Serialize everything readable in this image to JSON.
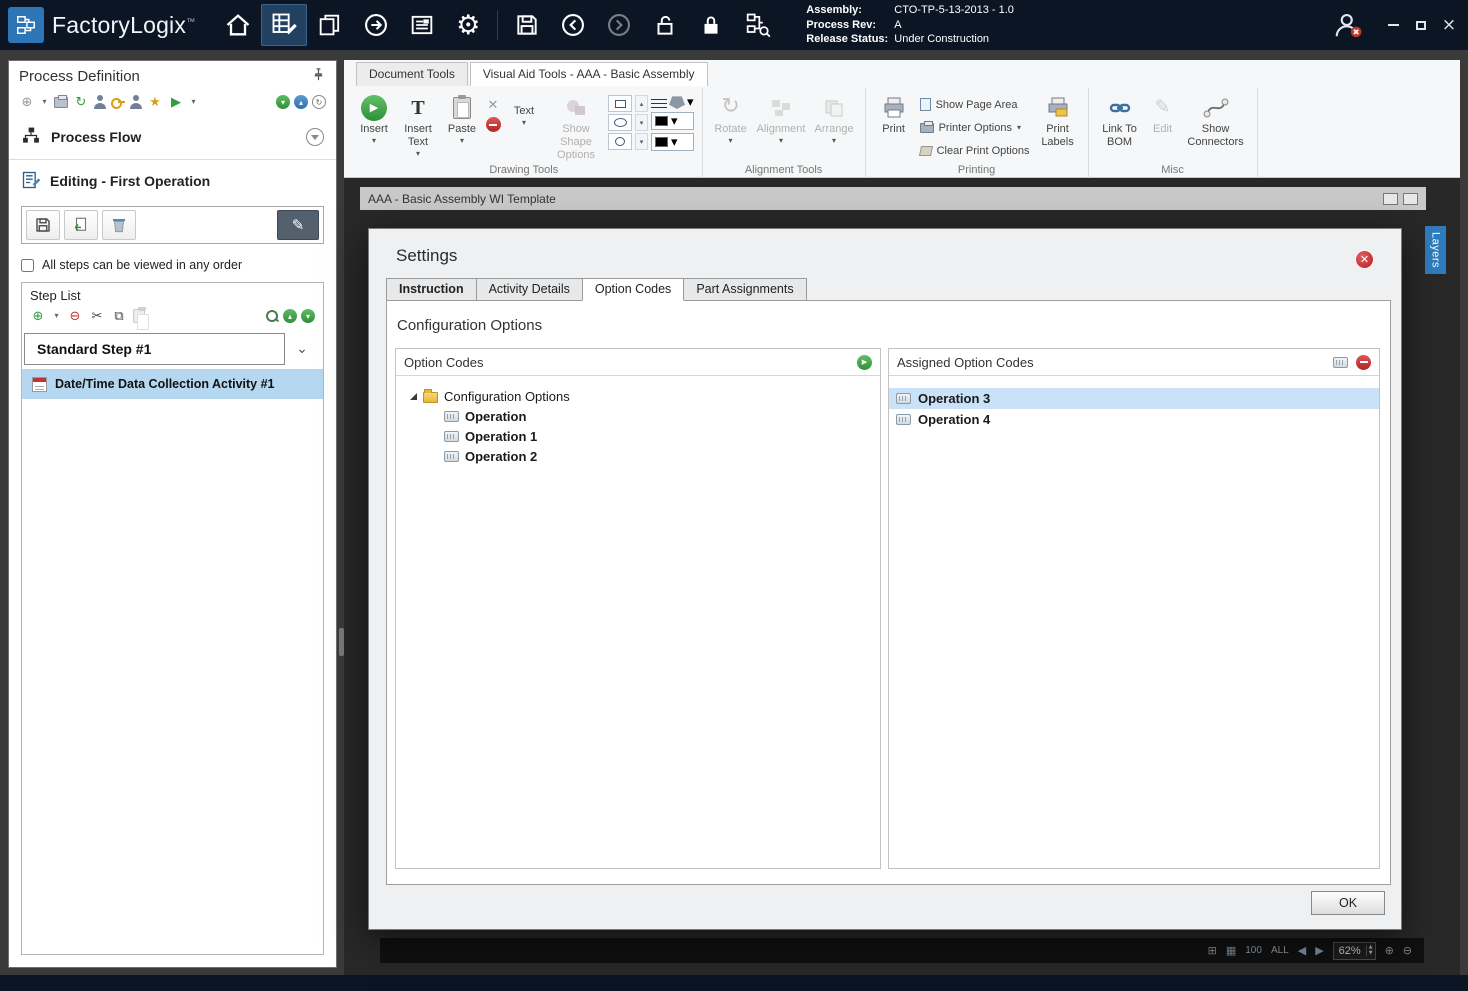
{
  "icons": {
    "caret_down": "▾",
    "chevron_down": "⌄",
    "gear": "⚙",
    "scissors": "✂",
    "star": "★",
    "play": "▶",
    "sync": "↻",
    "circle_plus": "⊕",
    "circle_minus": "⊖",
    "pencil": "✎",
    "close": "×",
    "up_triangle": "▴",
    "down_triangle": "▾",
    "left_arrow": "◀",
    "right_arrow": "▶",
    "spin_up": "▲",
    "spin_down": "▼",
    "grid": "▦",
    "grid_plus": "⊞",
    "copy": "⧉",
    "rotate": "↻",
    "x_mark": "✕"
  },
  "titlebar": {
    "app_name": "FactoryLogix",
    "trademark": "™",
    "status": {
      "assembly_label": "Assembly:",
      "assembly_value": "CTO-TP-5-13-2013 - 1.0",
      "process_rev_label": "Process Rev:",
      "process_rev_value": "A",
      "release_status_label": "Release Status:",
      "release_status_value": "Under Construction"
    }
  },
  "sidebar": {
    "title": "Process Definition",
    "process_flow": "Process Flow",
    "editing": "Editing - First Operation",
    "order_checkbox": "All steps can be viewed in any order",
    "step_list_title": "Step List",
    "step_name": "Standard Step #1",
    "activity_name": "Date/Time Data Collection Activity #1"
  },
  "ribbon": {
    "tabs": [
      {
        "label": "Document Tools"
      },
      {
        "label": "Visual Aid Tools - AAA - Basic Assembly"
      }
    ],
    "drawing": {
      "insert": "Insert",
      "insert_text": "Insert Text",
      "paste": "Paste",
      "text": "Text",
      "show_shape_options": "Show Shape Options",
      "group_label": "Drawing Tools"
    },
    "alignment": {
      "rotate": "Rotate",
      "alignment": "Alignment",
      "arrange": "Arrange",
      "group_label": "Alignment Tools"
    },
    "printing": {
      "print": "Print",
      "show_page_area": "Show Page Area",
      "printer_options": "Printer Options",
      "clear_print_options": "Clear Print Options",
      "print_labels": "Print Labels",
      "group_label": "Printing"
    },
    "misc": {
      "link_to_bom": "Link To BOM",
      "edit": "Edit",
      "show_connectors": "Show Connectors",
      "group_label": "Misc"
    }
  },
  "document": {
    "title": "AAA - Basic Assembly WI Template",
    "layers_tab": "Layers",
    "zoom": {
      "preset_100": "100",
      "preset_all": "ALL",
      "value": "62%"
    }
  },
  "dialog": {
    "title": "Settings",
    "tabs": [
      {
        "label": "Instruction"
      },
      {
        "label": "Activity Details"
      },
      {
        "label": "Option Codes"
      },
      {
        "label": "Part Assignments"
      }
    ],
    "section_title": "Configuration Options",
    "left_panel": {
      "header": "Option Codes",
      "root": "Configuration Options",
      "items": [
        {
          "label": "Operation"
        },
        {
          "label": "Operation 1"
        },
        {
          "label": "Operation 2"
        }
      ]
    },
    "right_panel": {
      "header": "Assigned Option Codes",
      "items": [
        {
          "label": "Operation 3"
        },
        {
          "label": "Operation 4"
        }
      ]
    },
    "ok": "OK"
  }
}
